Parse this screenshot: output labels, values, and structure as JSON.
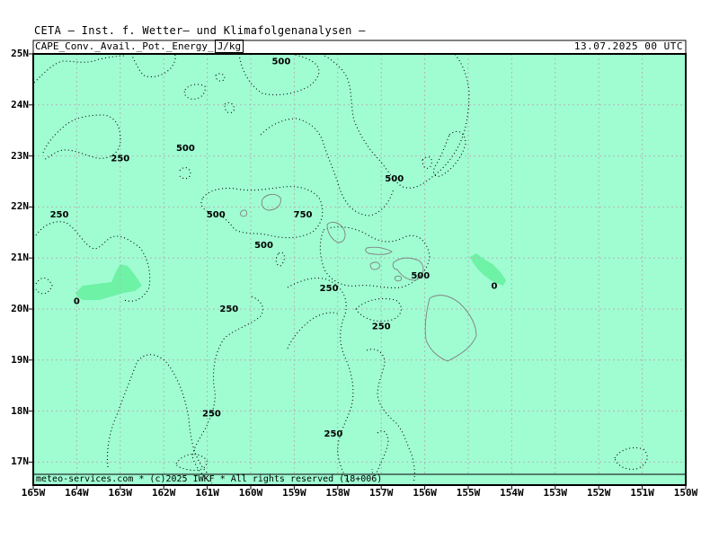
{
  "header": {
    "title": "CETA — Inst. f. Wetter— und Klimafolgenanalysen —",
    "parameter": "CAPE_Conv._Avail._Pot._Energy_",
    "unit": "J/kg",
    "datetime": "13.07.2025 00 UTC"
  },
  "footer": {
    "text": "meteo-services.com * (c)2025 IWKF * All rights reserved (18+006)"
  },
  "axes": {
    "latitudes": [
      "25N",
      "24N",
      "23N",
      "22N",
      "21N",
      "20N",
      "19N",
      "18N",
      "17N"
    ],
    "longitudes": [
      "165W",
      "164W",
      "163W",
      "162W",
      "161W",
      "160W",
      "159W",
      "158W",
      "157W",
      "156W",
      "155W",
      "154W",
      "153W",
      "152W",
      "151W",
      "150W"
    ]
  },
  "contour_labels": [
    {
      "text": "500",
      "lon": -159.3,
      "lat": 24.8
    },
    {
      "text": "250",
      "lon": -163.0,
      "lat": 22.9
    },
    {
      "text": "500",
      "lon": -161.5,
      "lat": 23.1
    },
    {
      "text": "500",
      "lon": -156.7,
      "lat": 22.5
    },
    {
      "text": "250",
      "lon": -164.4,
      "lat": 21.8
    },
    {
      "text": "500",
      "lon": -160.8,
      "lat": 21.8
    },
    {
      "text": "750",
      "lon": -158.8,
      "lat": 21.8
    },
    {
      "text": "500",
      "lon": -159.7,
      "lat": 21.2
    },
    {
      "text": "500",
      "lon": -156.1,
      "lat": 20.6
    },
    {
      "text": "250",
      "lon": -158.2,
      "lat": 20.35
    },
    {
      "text": "0",
      "lon": -164.0,
      "lat": 20.1
    },
    {
      "text": "0",
      "lon": -154.4,
      "lat": 20.4
    },
    {
      "text": "250",
      "lon": -160.5,
      "lat": 19.95
    },
    {
      "text": "250",
      "lon": -157.0,
      "lat": 19.6
    },
    {
      "text": "250",
      "lon": -160.9,
      "lat": 17.9
    },
    {
      "text": "250",
      "lon": -158.1,
      "lat": 17.5
    }
  ],
  "colors": {
    "background": "#a0fdd2",
    "zero_region": "#6ef2a6",
    "grid": "#b4b4b4",
    "coast": "#808080",
    "contour": "#000000"
  }
}
